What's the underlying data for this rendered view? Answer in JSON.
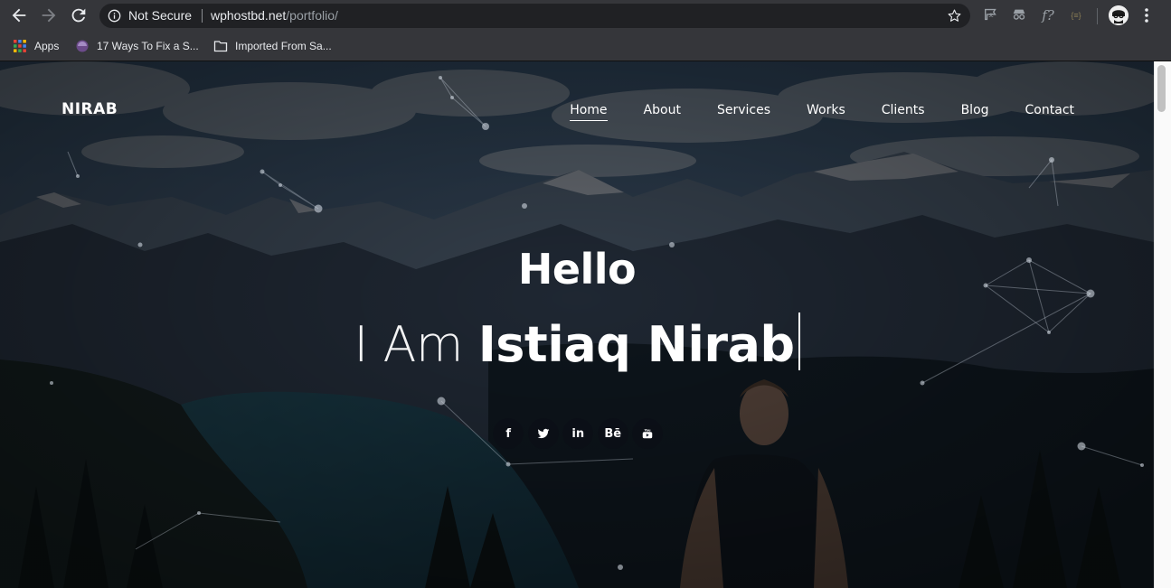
{
  "browser": {
    "security_label": "Not Secure",
    "url_host": "wphostbd.net",
    "url_path": "/portfolio/",
    "bookmarks": [
      {
        "label": "Apps",
        "icon": "apps-grid-icon"
      },
      {
        "label": "17 Ways To Fix a S...",
        "icon": "site-favicon-icon"
      },
      {
        "label": "Imported From Sa...",
        "icon": "folder-icon"
      }
    ],
    "extensions": [
      "translate-icon",
      "incognito-extension-icon",
      "function-extension-icon",
      "json-extension-icon"
    ]
  },
  "site": {
    "logo": "NIRAB",
    "nav": [
      {
        "label": "Home",
        "active": true
      },
      {
        "label": "About"
      },
      {
        "label": "Services"
      },
      {
        "label": "Works"
      },
      {
        "label": "Clients"
      },
      {
        "label": "Blog"
      },
      {
        "label": "Contact"
      }
    ],
    "hero": {
      "title": "Hello",
      "subtitle_prefix": "I Am ",
      "subtitle_name": "Istiaq Nirab"
    },
    "social": [
      {
        "label": "f",
        "icon": "facebook-icon"
      },
      {
        "label": "",
        "icon": "twitter-icon"
      },
      {
        "label": "in",
        "icon": "linkedin-icon"
      },
      {
        "label": "Bē",
        "icon": "behance-icon"
      },
      {
        "label": "",
        "icon": "youtube-icon"
      }
    ]
  },
  "colors": {
    "chrome_bg": "#35363a",
    "omnibox_bg": "#202124",
    "hero_overlay": "#0b1420",
    "text_white": "#ffffff"
  }
}
